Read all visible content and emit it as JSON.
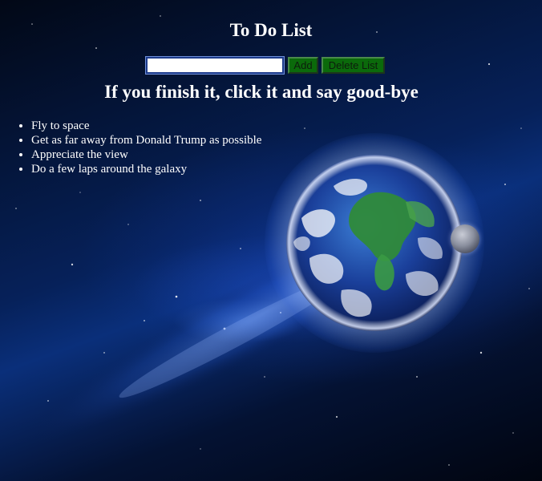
{
  "header": {
    "title": "To Do List"
  },
  "form": {
    "input_value": "",
    "add_label": "Add",
    "delete_label": "Delete List"
  },
  "instruction": "If you finish it, click it and say good-bye",
  "todos": [
    "Fly to space",
    "Get as far away from Donald Trump as possible",
    "Appreciate the view",
    "Do a few laps around the galaxy"
  ],
  "colors": {
    "button_background": "#0b6a0b",
    "text": "#ffffff",
    "background": "#06215a"
  },
  "background_image": {
    "subject": "earth-and-moon-in-space"
  }
}
